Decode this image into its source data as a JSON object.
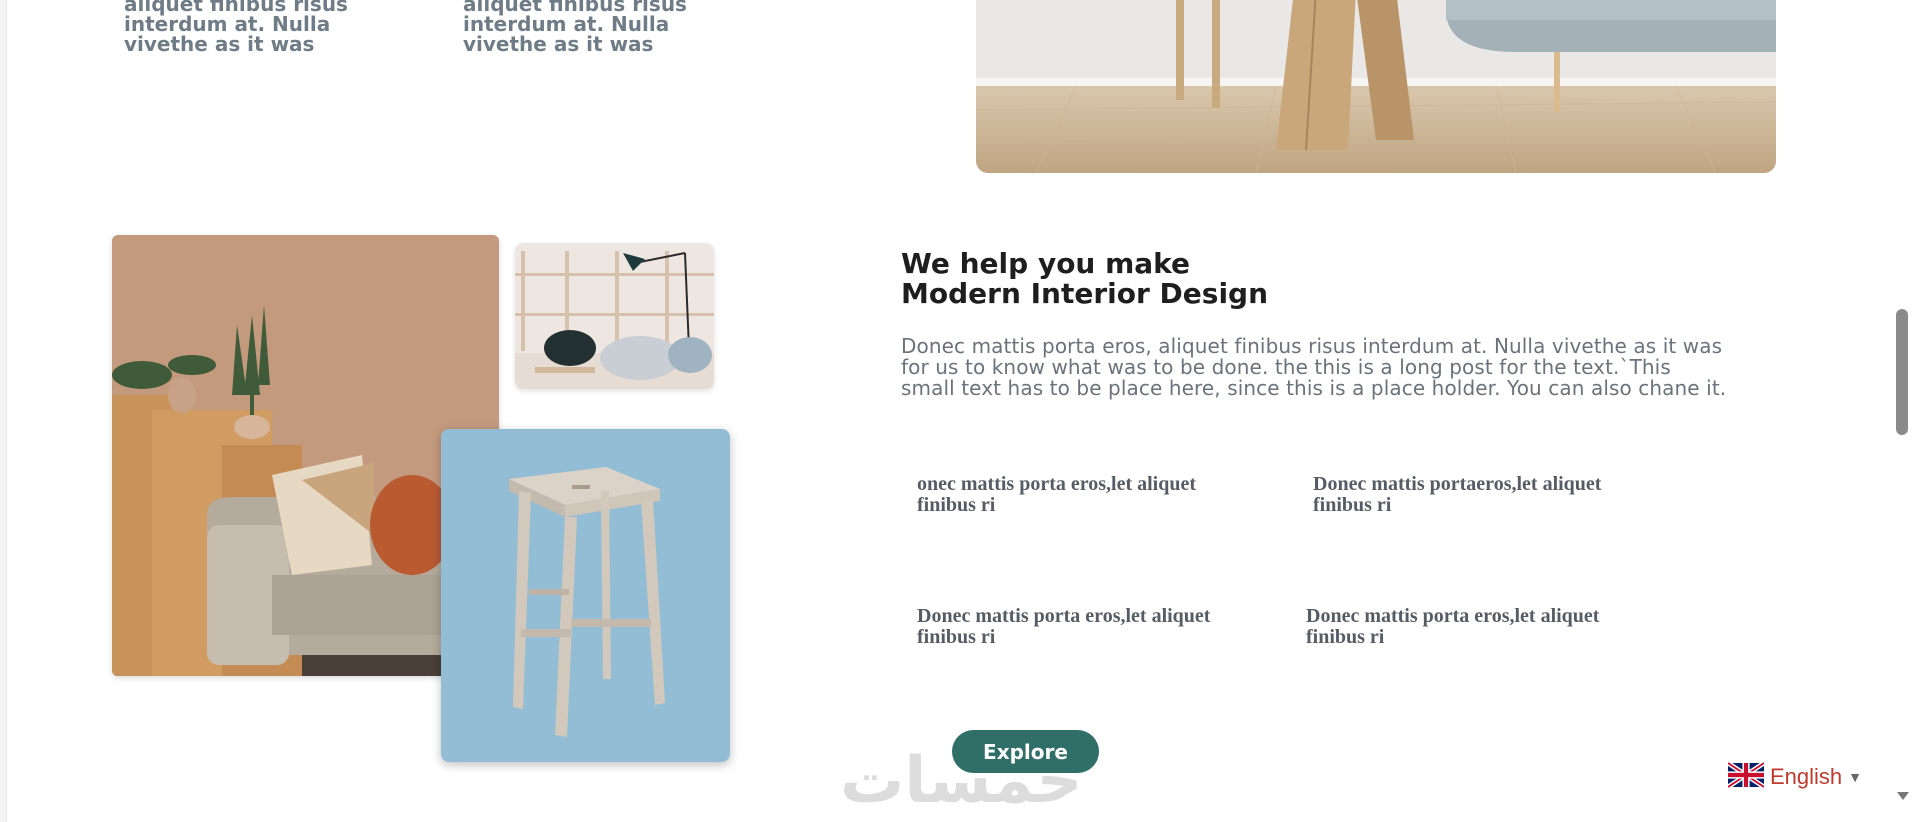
{
  "top_snippets": [
    "aliquet finibus risus interdum at. Nulla vivethe as it was",
    "aliquet finibus risus interdum at. Nulla vivethe as it was"
  ],
  "headline": {
    "line1": "We help you make",
    "line2": "Modern Interior Design"
  },
  "body": "Donec mattis porta eros, aliquet finibus risus interdum at. Nulla vivethe as it was for us to know what was to be done. the this is a long post for the text.`This small text has to be place here, since this is a place holder. You can also chane it.",
  "features": [
    "onec mattis porta eros,let aliquet finibus ri",
    "Donec mattis portaeros,let aliquet finibus ri",
    "Donec mattis porta eros,let aliquet finibus ri",
    "Donec mattis porta eros,let aliquet finibus ri"
  ],
  "explore_label": "Explore",
  "watermark": "خمسات",
  "language": {
    "label": "English",
    "flag": "uk-flag-icon"
  },
  "colors": {
    "accent": "#2f6f68",
    "language_text": "#c0392b",
    "heading": "#1e1e1e",
    "body_text": "#6b737a"
  }
}
